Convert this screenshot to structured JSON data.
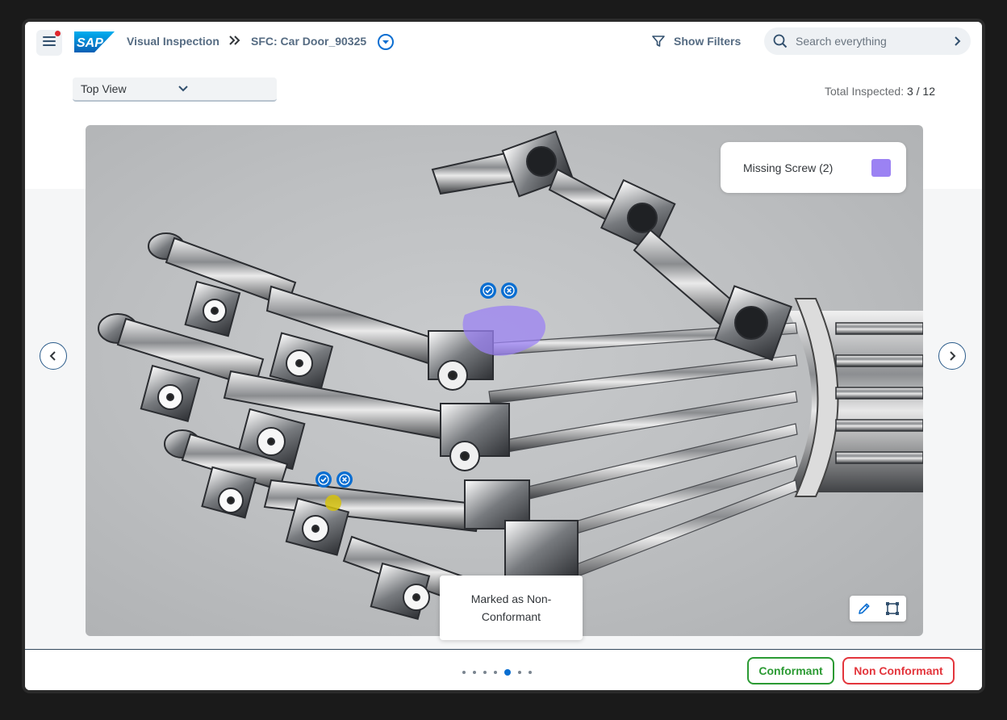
{
  "header": {
    "logo_text": "SAP",
    "breadcrumb_app": "Visual Inspection",
    "breadcrumb_current": "SFC: Car Door_90325",
    "show_filters": "Show Filters",
    "search_placeholder": "Search everything"
  },
  "toolbar": {
    "view_select": "Top View",
    "total_label": "Total Inspected:",
    "total_value": "3 / 12"
  },
  "viewer": {
    "legend": {
      "label": "Missing Screw (2)",
      "color": "#9b82f3"
    },
    "markers": [
      {
        "type": "region",
        "color": "#9b82f3"
      },
      {
        "type": "screw",
        "color": "#d6c20e"
      }
    ],
    "tooltip": "Marked as Non-Conformant",
    "tools": [
      "pencil-icon",
      "crop-frame-icon"
    ]
  },
  "pager": {
    "total": 7,
    "current": 5
  },
  "actions": {
    "conformant": "Conformant",
    "conformant_color": "#2b9a33",
    "non_conformant": "Non Conformant",
    "non_conformant_color": "#e3353c"
  },
  "colors": {
    "accent": "#0a6ed1",
    "nav": "#556b82"
  }
}
